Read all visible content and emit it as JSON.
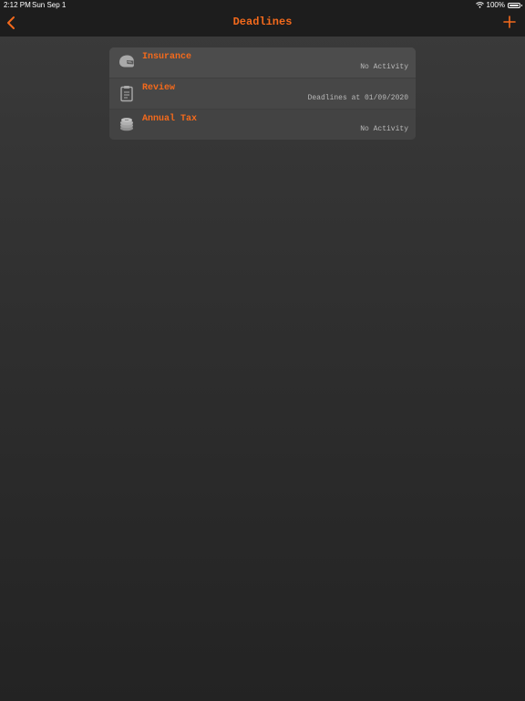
{
  "status_bar": {
    "time": "2:12 PM",
    "date": "Sun Sep 1",
    "battery": "100%",
    "wifi_icon": "wifi-icon",
    "battery_icon": "battery-icon"
  },
  "nav": {
    "title": "Deadlines",
    "back_icon": "chevron-left-icon",
    "add_icon": "plus-icon"
  },
  "colors": {
    "accent": "#f46a1c",
    "secondary_text": "#b9b9b9"
  },
  "list": {
    "items": [
      {
        "title": "Insurance",
        "status": "No Activity",
        "icon": "helmet-icon"
      },
      {
        "title": "Review",
        "status": "Deadlines at 01/09/2020",
        "icon": "clipboard-icon"
      },
      {
        "title": "Annual Tax",
        "status": "No Activity",
        "icon": "coin-stack-icon"
      }
    ]
  }
}
